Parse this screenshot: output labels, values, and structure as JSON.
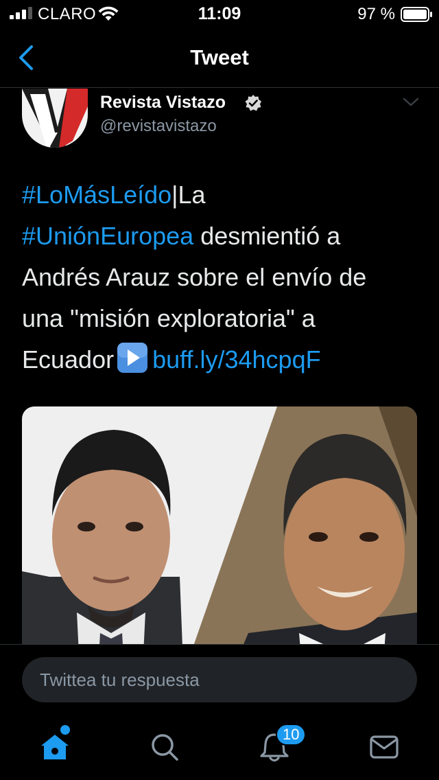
{
  "status_bar": {
    "carrier": "CLARO",
    "time": "11:09",
    "battery": "97 %"
  },
  "nav": {
    "title": "Tweet"
  },
  "tweet": {
    "author_name": "Revista Vistazo",
    "author_handle": "@revistavistazo",
    "lines": [
      {
        "hashtag": "#LoMásLeído",
        "rest": "|La"
      },
      {
        "hashtag": "#UniónEuropea",
        "rest": " desmientió a"
      },
      {
        "text": "Andrés Arauz sobre el envío de"
      },
      {
        "text": "una \"misión exploratoria\" a"
      },
      {
        "text": "Ecuador",
        "link": "buff.ly/34hcpqF"
      }
    ]
  },
  "reply": {
    "placeholder": "Twittea tu respuesta"
  },
  "tab_bar": {
    "notification_count": "10"
  },
  "colors": {
    "accent": "#1d9bf0",
    "background": "#000000",
    "secondary_text": "#8b98a5"
  }
}
